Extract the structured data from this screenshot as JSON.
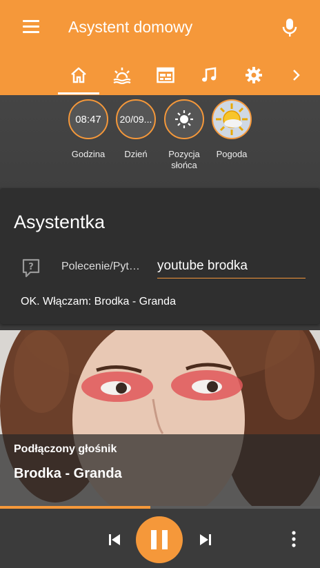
{
  "app": {
    "title": "Asystent domowy"
  },
  "tabs": [
    {
      "name": "home-icon",
      "active": true
    },
    {
      "name": "weather-sunset-icon"
    },
    {
      "name": "calendar-icon"
    },
    {
      "name": "music-note-icon"
    },
    {
      "name": "gear-icon"
    },
    {
      "name": "chevron-right-icon"
    }
  ],
  "stats": [
    {
      "value": "08:47",
      "label": "Godzina"
    },
    {
      "value": "20/09...",
      "label": "Dzień"
    },
    {
      "icon": "sun-icon",
      "label": "Pozycja słońca"
    },
    {
      "icon": "weather-sunny-icon",
      "label": "Pogoda"
    }
  ],
  "assistant": {
    "title": "Asystentka",
    "input_label": "Polecenie/Pytanie",
    "input_value": "youtube brodka",
    "response": "OK. Włączam: Brodka - Granda"
  },
  "player": {
    "speaker": "Podłączony głośnik",
    "track": "Brodka - Granda",
    "progress": 0.47
  },
  "colors": {
    "accent": "#f5983a",
    "background": "#3b3b3b",
    "card": "#2f2f2f"
  }
}
